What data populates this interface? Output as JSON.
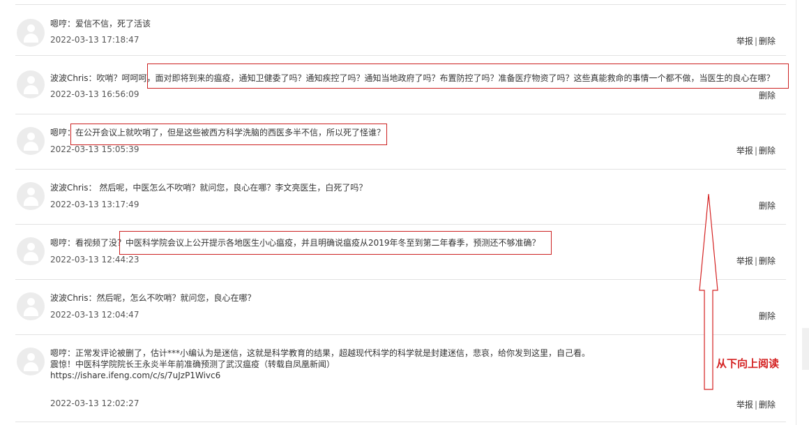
{
  "comments": [
    {
      "user": "嗯哼",
      "lines": [
        "：爱信不信，死了活该"
      ],
      "time": "2022-03-13 17:18:47",
      "report": "举报",
      "delete": "删除"
    },
    {
      "user": "波波Chris",
      "lines": [
        "：吹哨？呵呵呵，面对即将到来的瘟疫，通知卫健委了吗？通知疾控了吗？通知当地政府了吗？布置防控了吗？准备医疗物资了吗？这些真能救命的事情一个都不做，当医生的良心在哪？"
      ],
      "time": "2022-03-13 16:56:09",
      "delete": "删除"
    },
    {
      "user": "嗯哼",
      "lines": [
        "：在公开会议上就吹哨了，但是这些被西方科学洗脑的西医多半不信，所以死了怪谁？"
      ],
      "time": "2022-03-13 15:05:39",
      "report": "举报",
      "delete": "删除"
    },
    {
      "user": "波波Chris",
      "lines": [
        "： 然后呢，中医怎么不吹哨？就问您，良心在哪？李文亮医生，白死了吗？"
      ],
      "time": "2022-03-13 13:17:49",
      "delete": "删除"
    },
    {
      "user": "嗯哼",
      "lines": [
        "：看视频了没？中医科学院会议上公开提示各地医生小心瘟疫，并且明确说瘟疫从2019年冬至到第二年春季，预测还不够准确？"
      ],
      "time": "2022-03-13 12:44:23",
      "report": "举报",
      "delete": "删除"
    },
    {
      "user": "波波Chris",
      "lines": [
        "：然后呢，怎么不吹哨？就问您，良心在哪？"
      ],
      "time": "2022-03-13 12:04:47",
      "delete": "删除"
    },
    {
      "user": "嗯哼",
      "lines": [
        "：正常发评论被删了，估计***小编认为是迷信，这就是科学教育的结果，超越现代科学的科学就是封建迷信，悲哀，给你发到这里，自己看。",
        "震惊！中医科学院院长王永炎半年前准确预测了武汉瘟疫（转载自凤凰新闻）",
        "https://ishare.ifeng.com/c/s/7uJzP1Wivc6"
      ],
      "time": "2022-03-13 12:02:27",
      "report": "举报",
      "delete": "删除"
    }
  ],
  "annotation": {
    "text": "从下向上阅读",
    "color": "#d42020"
  },
  "colors": {
    "highlight_border": "#cc1f1f",
    "divider": "#e2e2e2"
  }
}
